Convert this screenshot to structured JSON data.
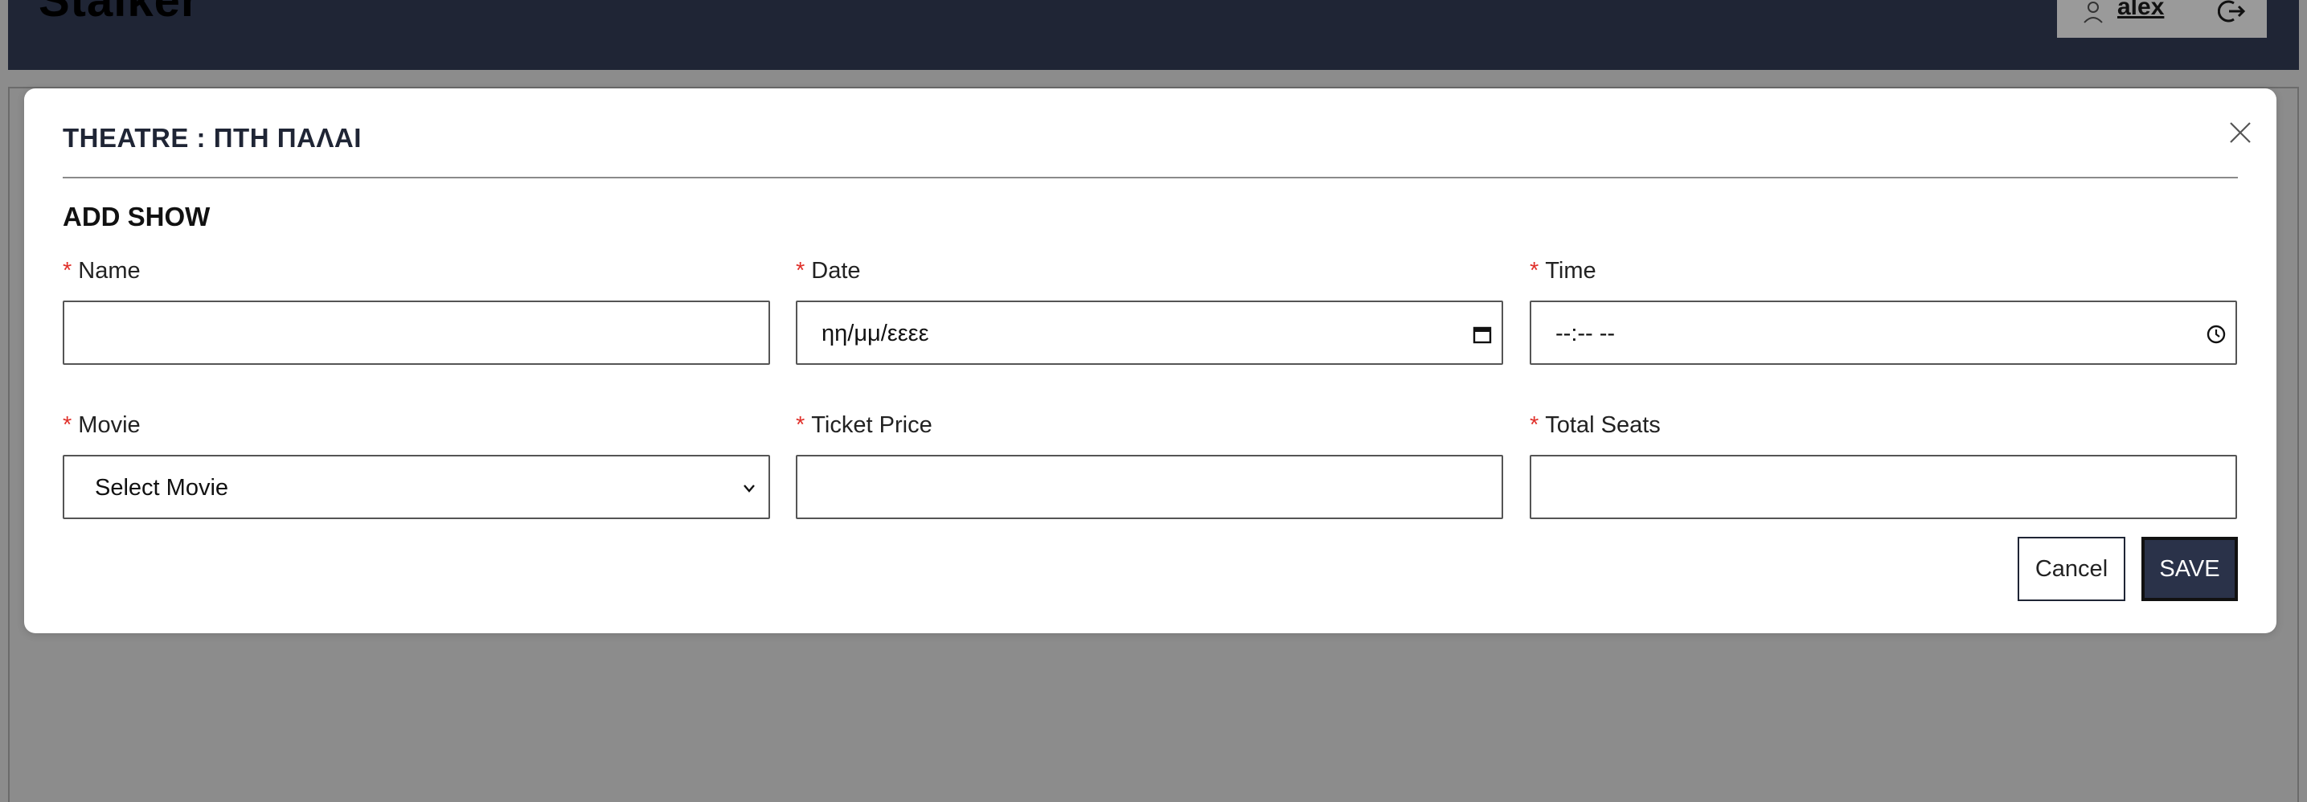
{
  "app": {
    "logo": "Stalker",
    "user": "alex"
  },
  "modal": {
    "title": "THEATRE : ΠΤΗ ΠΑΛΑΙ",
    "section_title": "ADD SHOW",
    "fields": {
      "name": {
        "label": "Name",
        "required_mark": "*",
        "value": ""
      },
      "date": {
        "label": "Date",
        "required_mark": "*",
        "placeholder": "ηη/μμ/εεεε"
      },
      "time": {
        "label": "Time",
        "required_mark": "*",
        "placeholder": "--:-- --"
      },
      "movie": {
        "label": "Movie",
        "required_mark": "*",
        "selected": "Select Movie"
      },
      "ticket_price": {
        "label": "Ticket Price",
        "required_mark": "*",
        "value": ""
      },
      "total_seats": {
        "label": "Total Seats",
        "required_mark": "*",
        "value": ""
      }
    },
    "buttons": {
      "cancel": "Cancel",
      "save": "SAVE"
    }
  },
  "icons": {
    "user": "user-icon",
    "logout": "logout-icon",
    "close": "close-icon",
    "calendar": "calendar-icon",
    "clock": "clock-icon",
    "dropdown": "chevron-down-icon"
  },
  "colors": {
    "header": "#1f2535",
    "overlay": "#8c8c8c",
    "required": "#e0302a",
    "save_button": "#2a3249"
  }
}
